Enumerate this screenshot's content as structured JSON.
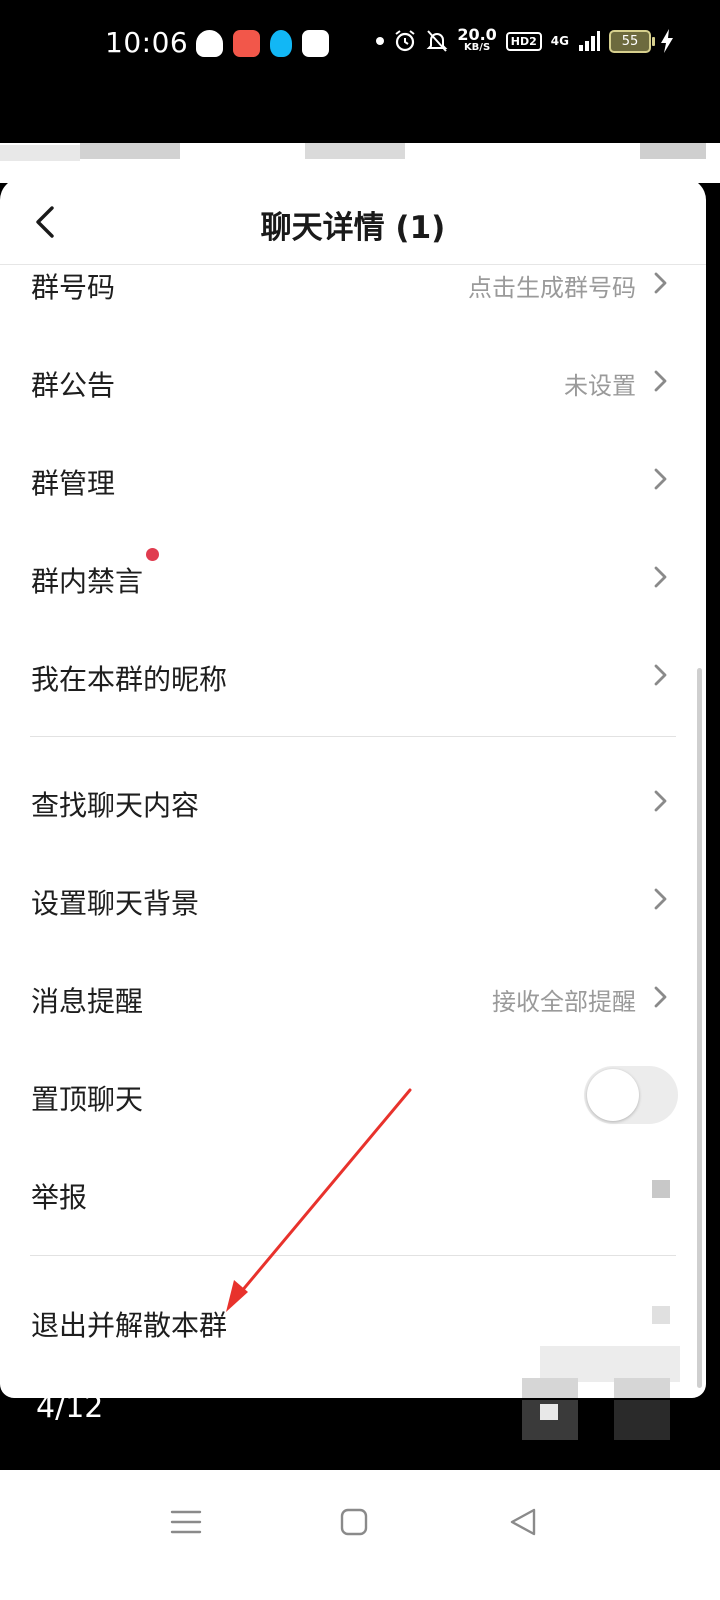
{
  "status_bar": {
    "time": "10:06",
    "net_speed_value": "20.0",
    "net_speed_unit": "KB/S",
    "hd_badge": "HD2",
    "network": "4G",
    "battery": "55",
    "app_icons": [
      "cat-app-icon",
      "kuaishou-icon",
      "qq-icon",
      "baidu-icon"
    ]
  },
  "header": {
    "title": "聊天详情 (1)"
  },
  "settings": {
    "group_number": {
      "label": "群号码",
      "value": "点击生成群号码"
    },
    "group_notice": {
      "label": "群公告",
      "value": "未设置"
    },
    "group_manage": {
      "label": "群管理"
    },
    "group_mute": {
      "label": "群内禁言"
    },
    "my_nickname": {
      "label": "我在本群的昵称"
    },
    "search_history": {
      "label": "查找聊天内容"
    },
    "chat_background": {
      "label": "设置聊天背景"
    },
    "message_alert": {
      "label": "消息提醒",
      "value": "接收全部提醒"
    },
    "pin_chat": {
      "label": "置顶聊天",
      "on": false
    },
    "report": {
      "label": "举报"
    },
    "dismiss_group": {
      "label": "退出并解散本群"
    }
  },
  "viewer": {
    "page_counter": "4/12"
  },
  "colors": {
    "accent_red": "#e03c4f",
    "annotation_arrow": "#e8322c"
  }
}
